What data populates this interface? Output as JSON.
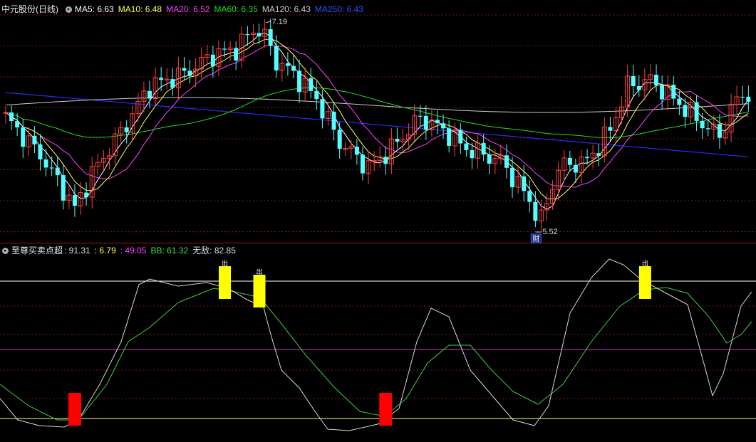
{
  "colors": {
    "up": "#ff4040",
    "down": "#54ffff",
    "ma5": "#ffffff",
    "ma10": "#ffff55",
    "ma20": "#ff44ff",
    "ma60": "#22dd22",
    "ma120": "#cccccc",
    "ma250": "#2a2aff",
    "grid": "#7a1a1a",
    "panel_border": "#a01818",
    "sell": "#ffff00",
    "buy": "#ff0000",
    "osc_white": "#d8d8d8",
    "osc_green": "#44cc44",
    "line_top": "#ffffff",
    "line_mid": "#cc33cc",
    "line_bottom": "#ffff66"
  },
  "main": {
    "title": "中元股份(日线)",
    "ma": [
      {
        "label": "MA5: 6.63",
        "color": "#ffffff"
      },
      {
        "label": "MA10: 6.48",
        "color": "#ffff55"
      },
      {
        "label": "MA20: 6.52",
        "color": "#ff44ff"
      },
      {
        "label": "MA60: 6.35",
        "color": "#22dd22"
      },
      {
        "label": "MA120: 6.43",
        "color": "#cccccc"
      },
      {
        "label": "MA250: 6.43",
        "color": "#3050ff"
      }
    ],
    "high_label": "7.19",
    "low_label": "5.52",
    "event_badge": "财"
  },
  "sub": {
    "title": "至尊买卖点超",
    "values": [
      {
        "label": ": 91.31",
        "color": "#dddddd"
      },
      {
        "label": ": 6.79",
        "color": "#ffff55"
      },
      {
        "label": ": 49.05",
        "color": "#ff44ff"
      },
      {
        "label": "BB: 61.32",
        "color": "#44dd44"
      },
      {
        "label": "无敌: 82.85",
        "color": "#dddddd"
      }
    ],
    "sell_label": "出"
  },
  "chart_data": {
    "type": "candlestick",
    "title": "中元股份(日线)",
    "high": 7.19,
    "low": 5.52,
    "sell_signal_indices": [
      38,
      44,
      111
    ],
    "buy_signal_indices": [
      12,
      66
    ]
  }
}
